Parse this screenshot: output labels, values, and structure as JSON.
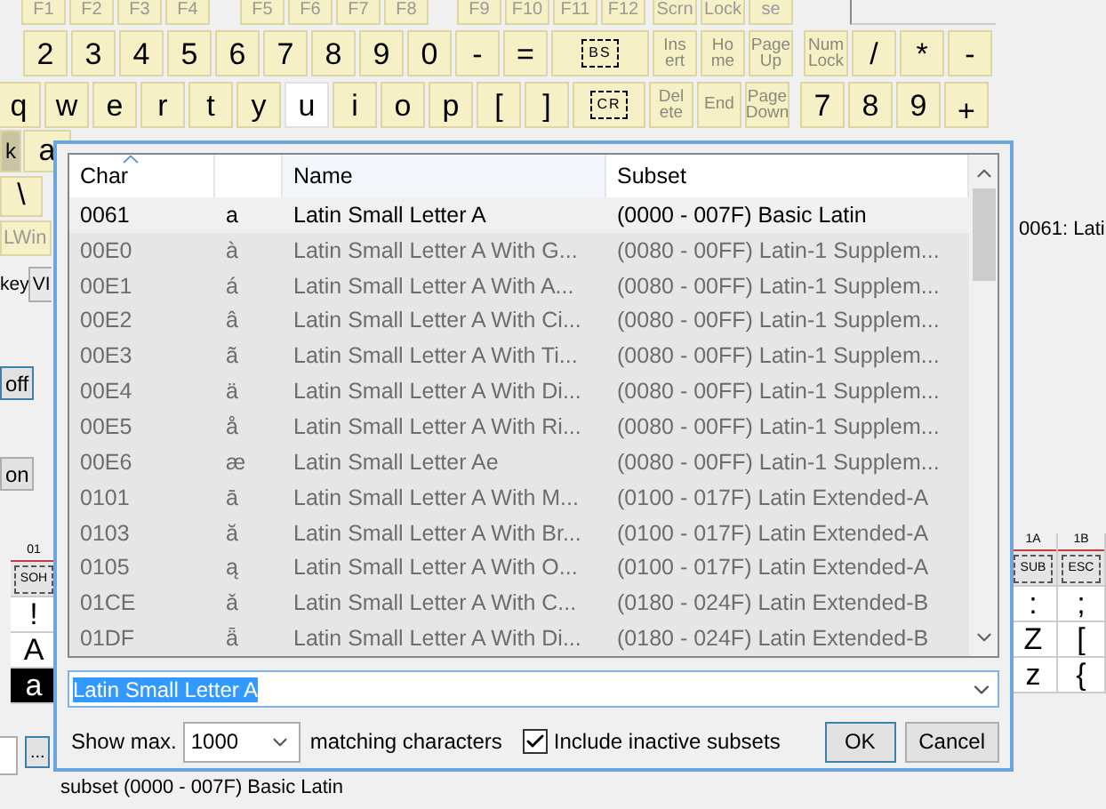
{
  "keyboard": {
    "rows": [
      {
        "groups": [
          {
            "keys": [
              {
                "label": "F1",
                "kind": "fn",
                "selected": false
              },
              {
                "label": "F2",
                "kind": "fn",
                "selected": false
              },
              {
                "label": "F3",
                "kind": "fn",
                "selected": false
              },
              {
                "label": "F4",
                "kind": "fn",
                "selected": false
              }
            ]
          },
          {
            "keys": [
              {
                "label": "F5",
                "kind": "fn",
                "selected": false
              },
              {
                "label": "F6",
                "kind": "fn",
                "selected": false
              },
              {
                "label": "F7",
                "kind": "fn",
                "selected": false
              },
              {
                "label": "F8",
                "kind": "fn",
                "selected": false
              }
            ]
          },
          {
            "keys": [
              {
                "label": "F9",
                "kind": "fn",
                "selected": false
              },
              {
                "label": "F10",
                "kind": "fn",
                "selected": false
              },
              {
                "label": "F11",
                "kind": "fn",
                "selected": false
              },
              {
                "label": "F12",
                "kind": "fn",
                "selected": false
              }
            ]
          },
          {
            "keys": [
              {
                "label": "Scrn",
                "kind": "fn",
                "selected": false
              },
              {
                "label": "Lock",
                "kind": "fn",
                "selected": false
              },
              {
                "label": "se",
                "kind": "fn",
                "selected": false
              }
            ]
          }
        ]
      },
      {
        "groups": [
          {
            "keys": [
              {
                "label": "2",
                "kind": "char",
                "selected": false
              },
              {
                "label": "3",
                "kind": "char",
                "selected": false
              },
              {
                "label": "4",
                "kind": "char",
                "selected": false
              },
              {
                "label": "5",
                "kind": "char",
                "selected": false
              },
              {
                "label": "6",
                "kind": "char",
                "selected": false
              },
              {
                "label": "7",
                "kind": "char",
                "selected": false
              },
              {
                "label": "8",
                "kind": "char",
                "selected": false
              },
              {
                "label": "9",
                "kind": "char",
                "selected": false
              },
              {
                "label": "0",
                "kind": "char",
                "selected": false
              },
              {
                "label": "-",
                "kind": "char",
                "selected": false
              },
              {
                "label": "=",
                "kind": "char",
                "selected": false
              },
              {
                "label": "BS",
                "kind": "boxed",
                "selected": false
              }
            ]
          },
          {
            "keys": [
              {
                "label": "Ins\nert",
                "kind": "nav",
                "selected": false
              },
              {
                "label": "Ho\nme",
                "kind": "nav",
                "selected": false
              },
              {
                "label": "Page\nUp",
                "kind": "nav",
                "selected": false
              }
            ]
          },
          {
            "keys": [
              {
                "label": "Num\nLock",
                "kind": "nav",
                "selected": false
              },
              {
                "label": "/",
                "kind": "char",
                "selected": false
              },
              {
                "label": "*",
                "kind": "char",
                "selected": false
              },
              {
                "label": "-",
                "kind": "char",
                "selected": false
              }
            ]
          }
        ]
      },
      {
        "groups": [
          {
            "keys": [
              {
                "label": "q",
                "kind": "char",
                "selected": false
              },
              {
                "label": "w",
                "kind": "char",
                "selected": false
              },
              {
                "label": "e",
                "kind": "char",
                "selected": false
              },
              {
                "label": "r",
                "kind": "char",
                "selected": false
              },
              {
                "label": "t",
                "kind": "char",
                "selected": false
              },
              {
                "label": "y",
                "kind": "char",
                "selected": false
              },
              {
                "label": "u",
                "kind": "char",
                "selected": true
              },
              {
                "label": "i",
                "kind": "char",
                "selected": false
              },
              {
                "label": "o",
                "kind": "char",
                "selected": false
              },
              {
                "label": "p",
                "kind": "char",
                "selected": false
              },
              {
                "label": "[",
                "kind": "char",
                "selected": false
              },
              {
                "label": "]",
                "kind": "char",
                "selected": false
              },
              {
                "label": "CR",
                "kind": "boxed",
                "selected": false
              }
            ]
          },
          {
            "keys": [
              {
                "label": "Del\nete",
                "kind": "nav",
                "selected": false
              },
              {
                "label": "End",
                "kind": "nav",
                "selected": false
              },
              {
                "label": "Page\nDown",
                "kind": "nav",
                "selected": false
              }
            ]
          },
          {
            "keys": [
              {
                "label": "7",
                "kind": "char",
                "selected": false
              },
              {
                "label": "8",
                "kind": "char",
                "selected": false
              },
              {
                "label": "9",
                "kind": "char",
                "selected": false
              },
              {
                "label": "+",
                "kind": "tall",
                "selected": false
              }
            ]
          }
        ]
      }
    ]
  },
  "left_panel": {
    "keys_row": [
      {
        "label": "k",
        "disabled": true
      },
      {
        "label": "a",
        "disabled": false
      }
    ],
    "backslash_key": "\\",
    "lwin_key": {
      "label": "LWin",
      "disabled": true
    },
    "key_label": "key",
    "key_select": "VI",
    "off_button": "off",
    "on_button": "on",
    "browse_button": "..."
  },
  "preview_text": "0061: Lati",
  "char_grid": {
    "columns": [
      {
        "header": "01",
        "cells": [
          {
            "text": "SOH",
            "kind": "control",
            "selected": false
          },
          {
            "text": "!",
            "kind": "char",
            "selected": false
          },
          {
            "text": "A",
            "kind": "char",
            "selected": false
          },
          {
            "text": "a",
            "kind": "char",
            "selected": true
          }
        ]
      },
      {
        "header": "1A",
        "cells": [
          {
            "text": "SUB",
            "kind": "control",
            "selected": false
          },
          {
            "text": ":",
            "kind": "char",
            "selected": false
          },
          {
            "text": "Z",
            "kind": "char",
            "selected": false
          },
          {
            "text": "z",
            "kind": "char",
            "selected": false
          }
        ]
      },
      {
        "header": "1B",
        "cells": [
          {
            "text": "ESC",
            "kind": "control",
            "selected": false
          },
          {
            "text": ";",
            "kind": "char",
            "selected": false
          },
          {
            "text": "[",
            "kind": "char",
            "selected": false
          },
          {
            "text": "{",
            "kind": "char",
            "selected": false
          }
        ]
      }
    ]
  },
  "status": "subset (0000 - 007F) Basic Latin",
  "dialog": {
    "table": {
      "columns": [
        {
          "kind": "text",
          "label": "Char",
          "sorted": true
        },
        {
          "kind": "blank",
          "sorted": false
        },
        {
          "kind": "text",
          "label": "Name",
          "sorted": false
        },
        {
          "kind": "text",
          "label": "Subset",
          "sorted": false
        }
      ],
      "rows": [
        {
          "code": "0061",
          "char": "a",
          "name": "Latin Small Letter A",
          "subset": "(0000 - 007F) Basic Latin",
          "inactive": false
        },
        {
          "code": "00E0",
          "char": "à",
          "name": "Latin Small Letter A With G...",
          "subset": "(0080 - 00FF) Latin-1 Supplem...",
          "inactive": true
        },
        {
          "code": "00E1",
          "char": "á",
          "name": "Latin Small Letter A With A...",
          "subset": "(0080 - 00FF) Latin-1 Supplem...",
          "inactive": true
        },
        {
          "code": "00E2",
          "char": "â",
          "name": "Latin Small Letter A With Ci...",
          "subset": "(0080 - 00FF) Latin-1 Supplem...",
          "inactive": true
        },
        {
          "code": "00E3",
          "char": "ã",
          "name": "Latin Small Letter A With Ti...",
          "subset": "(0080 - 00FF) Latin-1 Supplem...",
          "inactive": true
        },
        {
          "code": "00E4",
          "char": "ä",
          "name": "Latin Small Letter A With Di...",
          "subset": "(0080 - 00FF) Latin-1 Supplem...",
          "inactive": true
        },
        {
          "code": "00E5",
          "char": "å",
          "name": "Latin Small Letter A With Ri...",
          "subset": "(0080 - 00FF) Latin-1 Supplem...",
          "inactive": true
        },
        {
          "code": "00E6",
          "char": "æ",
          "name": "Latin Small Letter Ae",
          "subset": "(0080 - 00FF) Latin-1 Supplem...",
          "inactive": true
        },
        {
          "code": "0101",
          "char": "ā",
          "name": "Latin Small Letter A With M...",
          "subset": "(0100 - 017F) Latin Extended-A",
          "inactive": true
        },
        {
          "code": "0103",
          "char": "ă",
          "name": "Latin Small Letter A With Br...",
          "subset": "(0100 - 017F) Latin Extended-A",
          "inactive": true
        },
        {
          "code": "0105",
          "char": "ą",
          "name": "Latin Small Letter A With O...",
          "subset": "(0100 - 017F) Latin Extended-A",
          "inactive": true
        },
        {
          "code": "01CE",
          "char": "ǎ",
          "name": "Latin Small Letter A With C...",
          "subset": "(0180 - 024F) Latin Extended-B",
          "inactive": true
        },
        {
          "code": "01DF",
          "char": "ǟ",
          "name": "Latin Small Letter A With Di...",
          "subset": "(0180 - 024F) Latin Extended-B",
          "inactive": true
        }
      ]
    },
    "search": {
      "value": "Latin Small Letter A",
      "value_selected": true
    },
    "show_max": {
      "label": "Show max.",
      "value": "1000",
      "suffix": "matching characters"
    },
    "include_inactive": {
      "label": "Include inactive subsets",
      "checked": true
    },
    "buttons": [
      {
        "label": "OK",
        "default": true
      },
      {
        "label": "Cancel",
        "default": false
      }
    ]
  }
}
